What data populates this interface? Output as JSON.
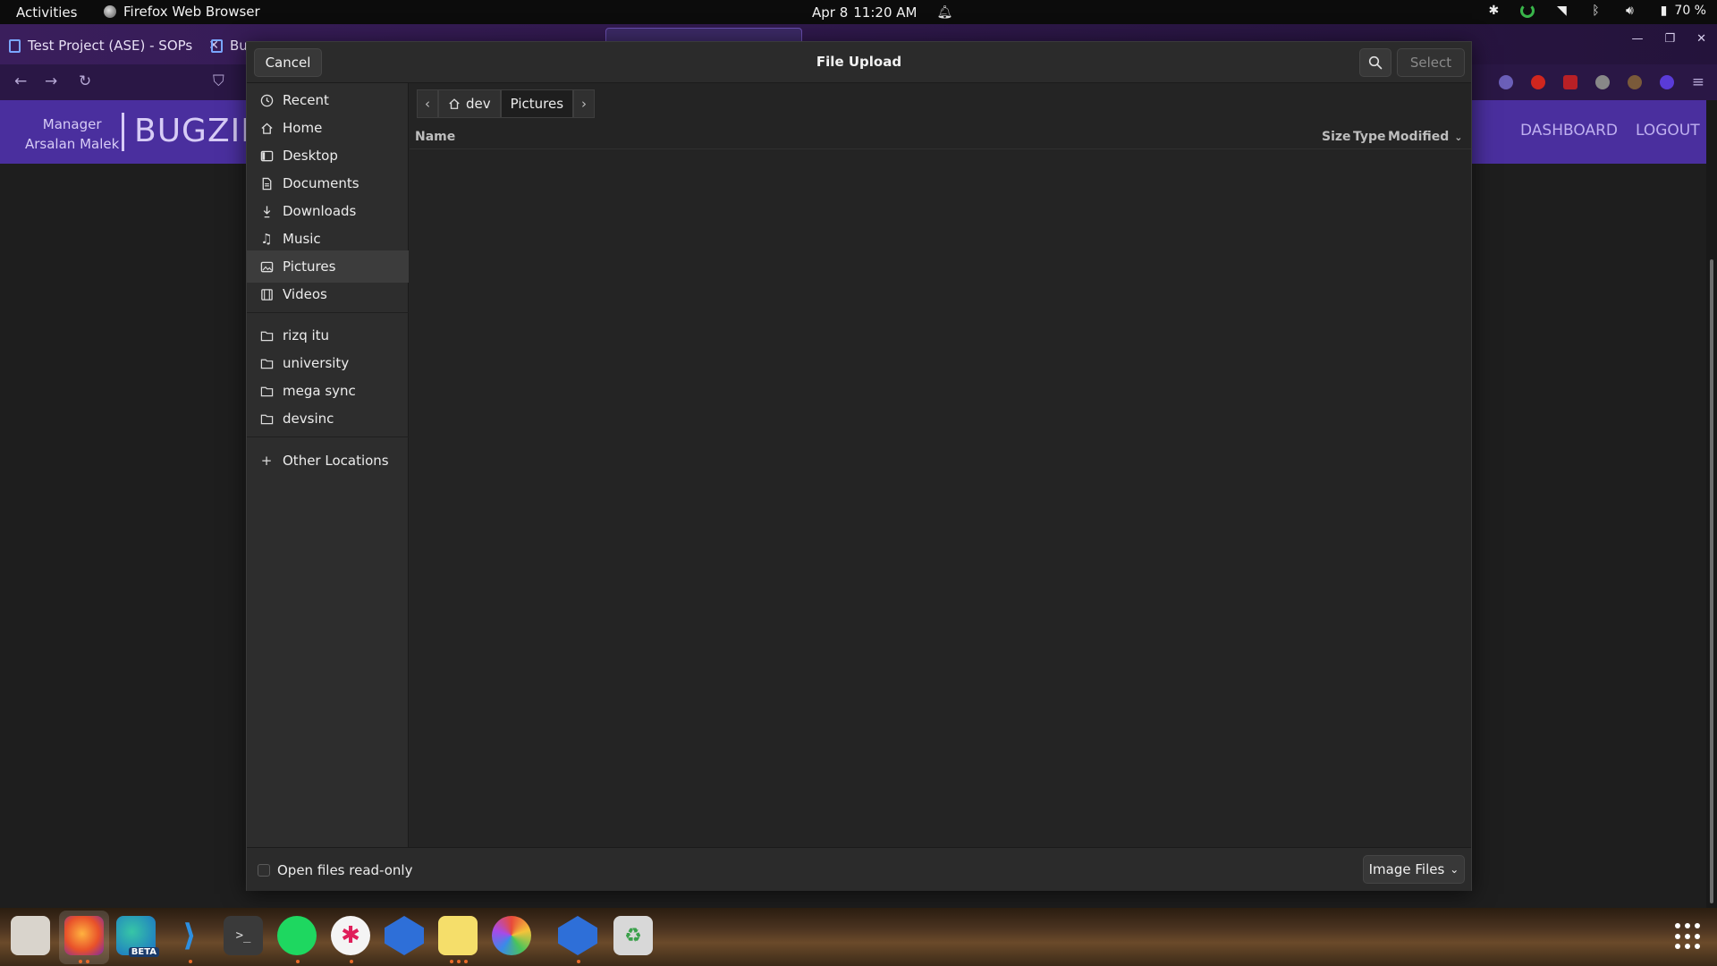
{
  "topbar": {
    "activities": "Activities",
    "app_name": "Firefox Web Browser",
    "date": "Apr 8",
    "time": "11:20 AM",
    "battery": "70 %"
  },
  "browser": {
    "tabs": [
      {
        "label": "Test Project (ASE) - SOPs"
      },
      {
        "label": "Bu"
      }
    ],
    "bugzilla": {
      "role": "Manager",
      "user": "Arsalan Malek",
      "brand": "BUGZILL",
      "nav": [
        "DASHBOARD",
        "LOGOUT"
      ]
    }
  },
  "dialog": {
    "title": "File Upload",
    "cancel_label": "Cancel",
    "select_label": "Select",
    "sidebar": {
      "places": [
        {
          "label": "Recent",
          "icon": "clock-icon"
        },
        {
          "label": "Home",
          "icon": "home-icon"
        },
        {
          "label": "Desktop",
          "icon": "desktop-icon"
        },
        {
          "label": "Documents",
          "icon": "document-icon"
        },
        {
          "label": "Downloads",
          "icon": "download-icon"
        },
        {
          "label": "Music",
          "icon": "music-icon"
        },
        {
          "label": "Pictures",
          "icon": "picture-icon",
          "selected": true
        },
        {
          "label": "Videos",
          "icon": "video-icon"
        }
      ],
      "bookmarks": [
        {
          "label": "rizq itu",
          "icon": "folder-icon"
        },
        {
          "label": "university",
          "icon": "folder-icon"
        },
        {
          "label": "mega sync",
          "icon": "folder-icon"
        },
        {
          "label": "devsinc",
          "icon": "folder-icon"
        }
      ],
      "other_locations": "Other Locations"
    },
    "pathbar": {
      "home_segment": "dev",
      "current_segment": "Pictures"
    },
    "columns": {
      "name": "Name",
      "size": "Size",
      "type": "Type",
      "modified": "Modified"
    },
    "footer": {
      "read_only_label": "Open files read-only",
      "read_only_checked": false,
      "filter_label": "Image Files"
    }
  },
  "dock": {
    "apps": [
      "files-icon",
      "firefox-icon",
      "edge-beta-icon",
      "vscode-icon",
      "terminal-icon",
      "spotify-icon",
      "slack-icon",
      "app-icon",
      "notes-icon",
      "color-picker-icon",
      "app-icon",
      "trash-icon"
    ],
    "edge_badge": "BETA"
  }
}
